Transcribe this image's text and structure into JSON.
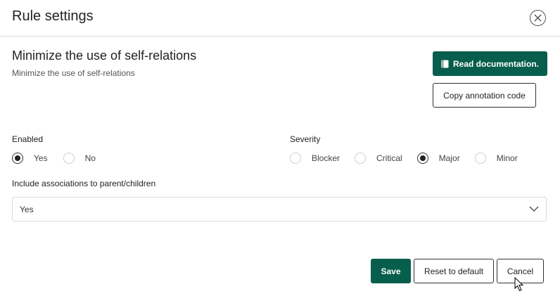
{
  "dialog": {
    "title": "Rule settings",
    "close_icon": "close-circle-icon"
  },
  "rule": {
    "name": "Minimize the use of self-relations",
    "description": "Minimize the use of self-relations"
  },
  "actions": {
    "read_docs_label": "Read documentation.",
    "read_docs_icon": "book-icon",
    "copy_code_label": "Copy annotation code"
  },
  "enabled": {
    "label": "Enabled",
    "options": [
      "Yes",
      "No"
    ],
    "selected": "Yes"
  },
  "severity": {
    "label": "Severity",
    "options": [
      "Blocker",
      "Critical",
      "Major",
      "Minor"
    ],
    "selected": "Major"
  },
  "associations": {
    "label": "Include associations to parent/children",
    "value": "Yes",
    "chevron_icon": "chevron-down-icon"
  },
  "footer": {
    "save_label": "Save",
    "reset_label": "Reset to default",
    "cancel_label": "Cancel"
  },
  "colors": {
    "primary": "#075e4c",
    "border": "#333333",
    "divider": "#d9d9d9"
  }
}
